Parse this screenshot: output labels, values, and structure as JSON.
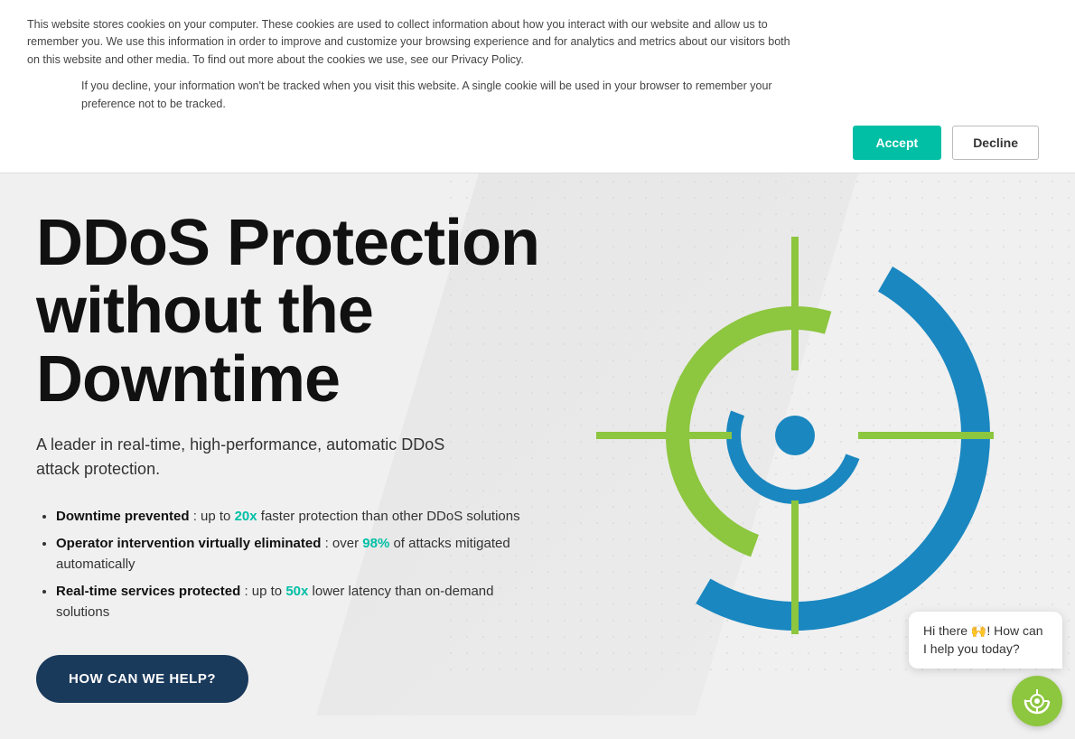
{
  "cookie": {
    "main_text": "This website stores cookies on your computer. These cookies are used to collect information about how you interact with our website and allow us to remember you. We use this information in order to improve and customize your browsing experience and for analytics and metrics about our visitors both on this website and other media. To find out more about the cookies we use, see our Privacy Policy.",
    "sub_text": "If you decline, your information won't be tracked when you visit this website. A single cookie will be used in your browser to remember your preference not to be tracked.",
    "accept_label": "Accept",
    "decline_label": "Decline"
  },
  "hero": {
    "title": "DDoS Protection without the Downtime",
    "subtitle": "A leader in real-time, high-performance, automatic DDoS attack protection.",
    "bullets": [
      {
        "bold": "Downtime prevented",
        "rest": ": up to ",
        "highlight": "20x",
        "tail": " faster protection than other DDoS solutions"
      },
      {
        "bold": "Operator intervention virtually eliminated",
        "rest": ": over ",
        "highlight": "98%",
        "tail": " of attacks mitigated automatically"
      },
      {
        "bold": "Real-time services protected",
        "rest": ": up to ",
        "highlight": "50x",
        "tail": " lower latency than on-demand solutions"
      }
    ],
    "cta_label": "HOW CAN WE HELP?",
    "colors": {
      "teal": "#00bfa5",
      "green": "#8dc63f",
      "dark_blue": "#1a3a5c",
      "blue": "#1a87c0"
    }
  },
  "chat": {
    "bubble_text": "Hi there 🙌! How can I help you today?"
  }
}
